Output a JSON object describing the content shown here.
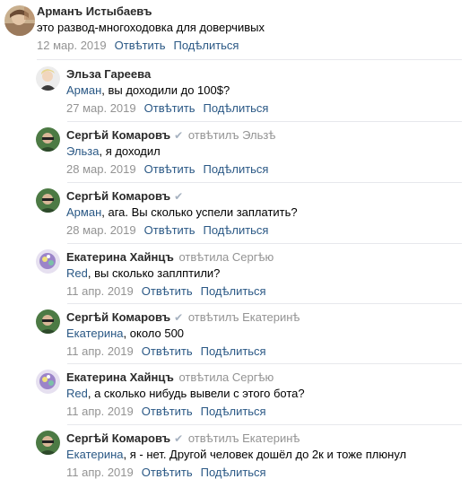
{
  "comments": [
    {
      "author": "Арманъ Истыбаевъ",
      "reply_to": "",
      "verified": false,
      "mention": "",
      "text": "это развод-многоходовка для доверчивых",
      "date": "12 мар. 2019",
      "reply_label": "Отвѣтить",
      "share_label": "Подѣлиться",
      "avatar": "user-photo-arman"
    },
    {
      "author": "Эльза Гареева",
      "reply_to": "",
      "verified": false,
      "mention": "Арман",
      "text": ", вы доходили до 100$?",
      "date": "27 мар. 2019",
      "reply_label": "Отвѣтить",
      "share_label": "Подѣлиться",
      "avatar": "user-photo-elza"
    },
    {
      "author": "Сергѣй Комаровъ",
      "reply_to": "отвѣтилъ Эльзѣ",
      "verified": true,
      "mention": "Эльза",
      "text": ", я доходил",
      "date": "28 мар. 2019",
      "reply_label": "Отвѣтить",
      "share_label": "Подѣлиться",
      "avatar": "user-photo-sergey"
    },
    {
      "author": "Сергѣй Комаровъ",
      "reply_to": "",
      "verified": true,
      "mention": "Арман",
      "text": ", ага. Вы сколько успели заплатить?",
      "date": "28 мар. 2019",
      "reply_label": "Отвѣтить",
      "share_label": "Подѣлиться",
      "avatar": "user-photo-sergey"
    },
    {
      "author": "Екатерина Хайнцъ",
      "reply_to": "отвѣтила Сергѣю",
      "verified": false,
      "mention": "Red",
      "text": ", вы сколько заплптили?",
      "date": "11 апр. 2019",
      "reply_label": "Отвѣтить",
      "share_label": "Подѣлиться",
      "avatar": "user-photo-ekaterina"
    },
    {
      "author": "Сергѣй Комаровъ",
      "reply_to": "отвѣтилъ Екатеринѣ",
      "verified": true,
      "mention": "Екатерина",
      "text": ", около 500",
      "date": "11 апр. 2019",
      "reply_label": "Отвѣтить",
      "share_label": "Подѣлиться",
      "avatar": "user-photo-sergey"
    },
    {
      "author": "Екатерина Хайнцъ",
      "reply_to": "отвѣтила Сергѣю",
      "verified": false,
      "mention": "Red",
      "text": ", а сколько нибудь вывели с этого бота?",
      "date": "11 апр. 2019",
      "reply_label": "Отвѣтить",
      "share_label": "Подѣлиться",
      "avatar": "user-photo-ekaterina"
    },
    {
      "author": "Сергѣй Комаровъ",
      "reply_to": "отвѣтилъ Екатеринѣ",
      "verified": true,
      "mention": "Екатерина",
      "text": ", я - нет. Другой человек дошёл до 2к и тоже плюнул",
      "date": "11 апр. 2019",
      "reply_label": "Отвѣтить",
      "share_label": "Подѣлиться",
      "avatar": "user-photo-sergey"
    }
  ]
}
